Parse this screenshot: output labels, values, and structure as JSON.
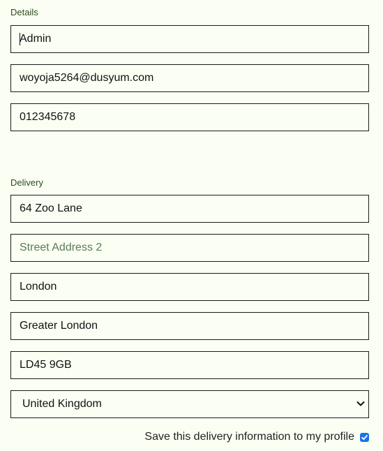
{
  "details": {
    "label": "Details",
    "name_value": "Admin",
    "email_value": "woyoja5264@dusyum.com",
    "phone_value": "012345678"
  },
  "delivery": {
    "label": "Delivery",
    "street1_value": "64 Zoo Lane",
    "street2_placeholder": "Street Address 2",
    "city_value": "London",
    "county_value": "Greater London",
    "postcode_value": "LD45 9GB",
    "country_selected": "United Kingdom"
  },
  "save": {
    "label": "Save this delivery information to my profile",
    "checked": true
  },
  "colors": {
    "background": "#fbfff3",
    "label_text": "#2e4a1f",
    "placeholder": "#5a7a5a",
    "checkbox_accent": "#1a73e8"
  },
  "icons": [
    "chevron-down-icon",
    "checkmark-icon"
  ]
}
